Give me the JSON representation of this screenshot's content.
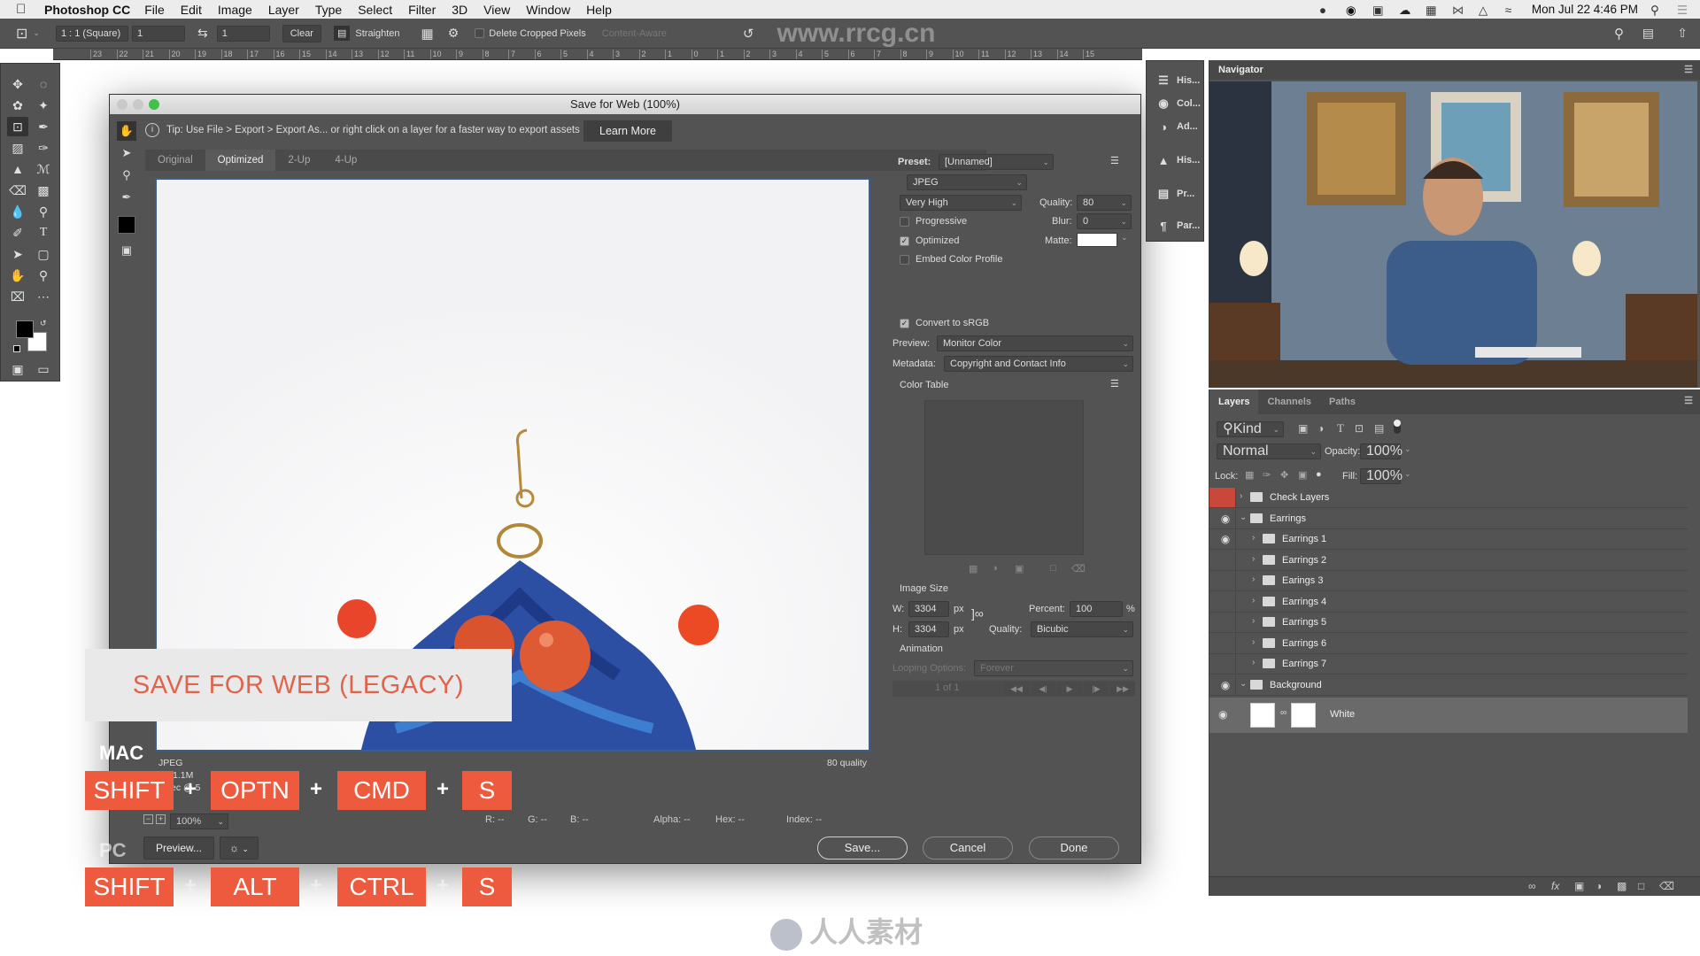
{
  "menubar": {
    "app_name": "Photoshop CC",
    "items": [
      "File",
      "Edit",
      "Image",
      "Layer",
      "Type",
      "Select",
      "Filter",
      "3D",
      "View",
      "Window",
      "Help"
    ],
    "clock": "Mon Jul 22  4:46 PM"
  },
  "options_bar": {
    "ratio": "1 : 1 (Square)",
    "width_value": "1",
    "height_value": "1",
    "clear_label": "Clear",
    "straighten_label": "Straighten",
    "delete_cropped_label": "Delete Cropped Pixels",
    "content_aware_label": "Content-Aware",
    "watermark": "www.rrcg.cn"
  },
  "ruler": {
    "ticks": [
      "23",
      "22",
      "21",
      "20",
      "19",
      "18",
      "17",
      "16",
      "15",
      "14",
      "13",
      "12",
      "11",
      "10",
      "9",
      "8",
      "7",
      "6",
      "5",
      "4",
      "3",
      "2",
      "1",
      "0",
      "1",
      "2",
      "3",
      "4",
      "5",
      "6",
      "7",
      "8",
      "9",
      "10",
      "11",
      "12",
      "13",
      "14",
      "15"
    ]
  },
  "dialog": {
    "title": "Save for Web (100%)",
    "tip": "Tip: Use File > Export > Export As...  or right click on a layer for a faster way to export assets",
    "learn_more": "Learn More",
    "tabs": [
      {
        "label": "Original",
        "active": false
      },
      {
        "label": "Optimized",
        "active": true
      },
      {
        "label": "2-Up",
        "active": false
      },
      {
        "label": "4-Up",
        "active": false
      }
    ],
    "preview_info": {
      "format": "JPEG",
      "size": "1.1M",
      "time": "0 sec @ 5",
      "quality": "80 quality"
    },
    "status": {
      "zoom": "100%",
      "r": "R: --",
      "g": "G: --",
      "b": "B: --",
      "alpha": "Alpha: --",
      "hex": "Hex: --",
      "index": "Index: --"
    },
    "preview_button": "Preview...",
    "save_button": "Save...",
    "cancel_button": "Cancel",
    "done_button": "Done"
  },
  "settings": {
    "preset_label": "Preset:",
    "preset_value": "[Unnamed]",
    "format": "JPEG",
    "compression": "Very High",
    "quality_label": "Quality:",
    "quality_value": "80",
    "blur_label": "Blur:",
    "blur_value": "0",
    "matte_label": "Matte:",
    "matte_color": "#ffffff",
    "progressive": {
      "label": "Progressive",
      "checked": false
    },
    "optimized": {
      "label": "Optimized",
      "checked": true
    },
    "embed_profile": {
      "label": "Embed Color Profile",
      "checked": false
    },
    "convert_srgb": {
      "label": "Convert to sRGB",
      "checked": true
    },
    "preview_label": "Preview:",
    "preview_value": "Monitor Color",
    "metadata_label": "Metadata:",
    "metadata_value": "Copyright and Contact Info",
    "color_table_label": "Color Table",
    "image_size_label": "Image Size",
    "w_label": "W:",
    "w_value": "3304",
    "h_label": "H:",
    "h_value": "3304",
    "px_unit": "px",
    "percent_label": "Percent:",
    "percent_value": "100",
    "percent_unit": "%",
    "resample_label": "Quality:",
    "resample_value": "Bicubic",
    "animation_label": "Animation",
    "looping_label": "Looping Options:",
    "looping_value": "Forever",
    "frame_counter": "1 of 1"
  },
  "overlay": {
    "banner": "SAVE FOR WEB (LEGACY)",
    "mac_label": "MAC",
    "pc_label": "PC",
    "mac_keys": [
      "SHIFT",
      "OPTN",
      "CMD",
      "S"
    ],
    "pc_keys": [
      "SHIFT",
      "ALT",
      "CTRL",
      "S"
    ],
    "plus": "+",
    "key_color": "#ee5a3e",
    "banner_text_color": "#e0634a"
  },
  "dock": {
    "items": [
      "His...",
      "Col...",
      "Ad...",
      "His...",
      "Pr...",
      "Par..."
    ]
  },
  "navigator": {
    "title": "Navigator"
  },
  "layers": {
    "tabs": [
      {
        "label": "Layers",
        "active": true
      },
      {
        "label": "Channels",
        "active": false
      },
      {
        "label": "Paths",
        "active": false
      }
    ],
    "filter_kind": "Kind",
    "blend_mode": "Normal",
    "opacity_label": "Opacity:",
    "opacity_value": "100%",
    "lock_label": "Lock:",
    "fill_label": "Fill:",
    "fill_value": "100%",
    "rows": [
      {
        "name": "Check Layers",
        "visible": false,
        "level": 0,
        "expanded": false,
        "red_tag": true
      },
      {
        "name": "Earrings",
        "visible": true,
        "level": 0,
        "expanded": true
      },
      {
        "name": "Earrings 1",
        "visible": true,
        "level": 1,
        "expanded": false
      },
      {
        "name": "Earrings 2",
        "visible": false,
        "level": 1,
        "expanded": false
      },
      {
        "name": "Earings 3",
        "visible": false,
        "level": 1,
        "expanded": false
      },
      {
        "name": "Earrings 4",
        "visible": false,
        "level": 1,
        "expanded": false
      },
      {
        "name": "Earrings 5",
        "visible": false,
        "level": 1,
        "expanded": false
      },
      {
        "name": "Earrings 6",
        "visible": false,
        "level": 1,
        "expanded": false
      },
      {
        "name": "Earrings 7",
        "visible": false,
        "level": 1,
        "expanded": false
      },
      {
        "name": "Background",
        "visible": true,
        "level": 0,
        "expanded": true
      }
    ],
    "selected_layer": {
      "name": "White",
      "visible": true
    }
  },
  "watermark_footer": "人人素材"
}
